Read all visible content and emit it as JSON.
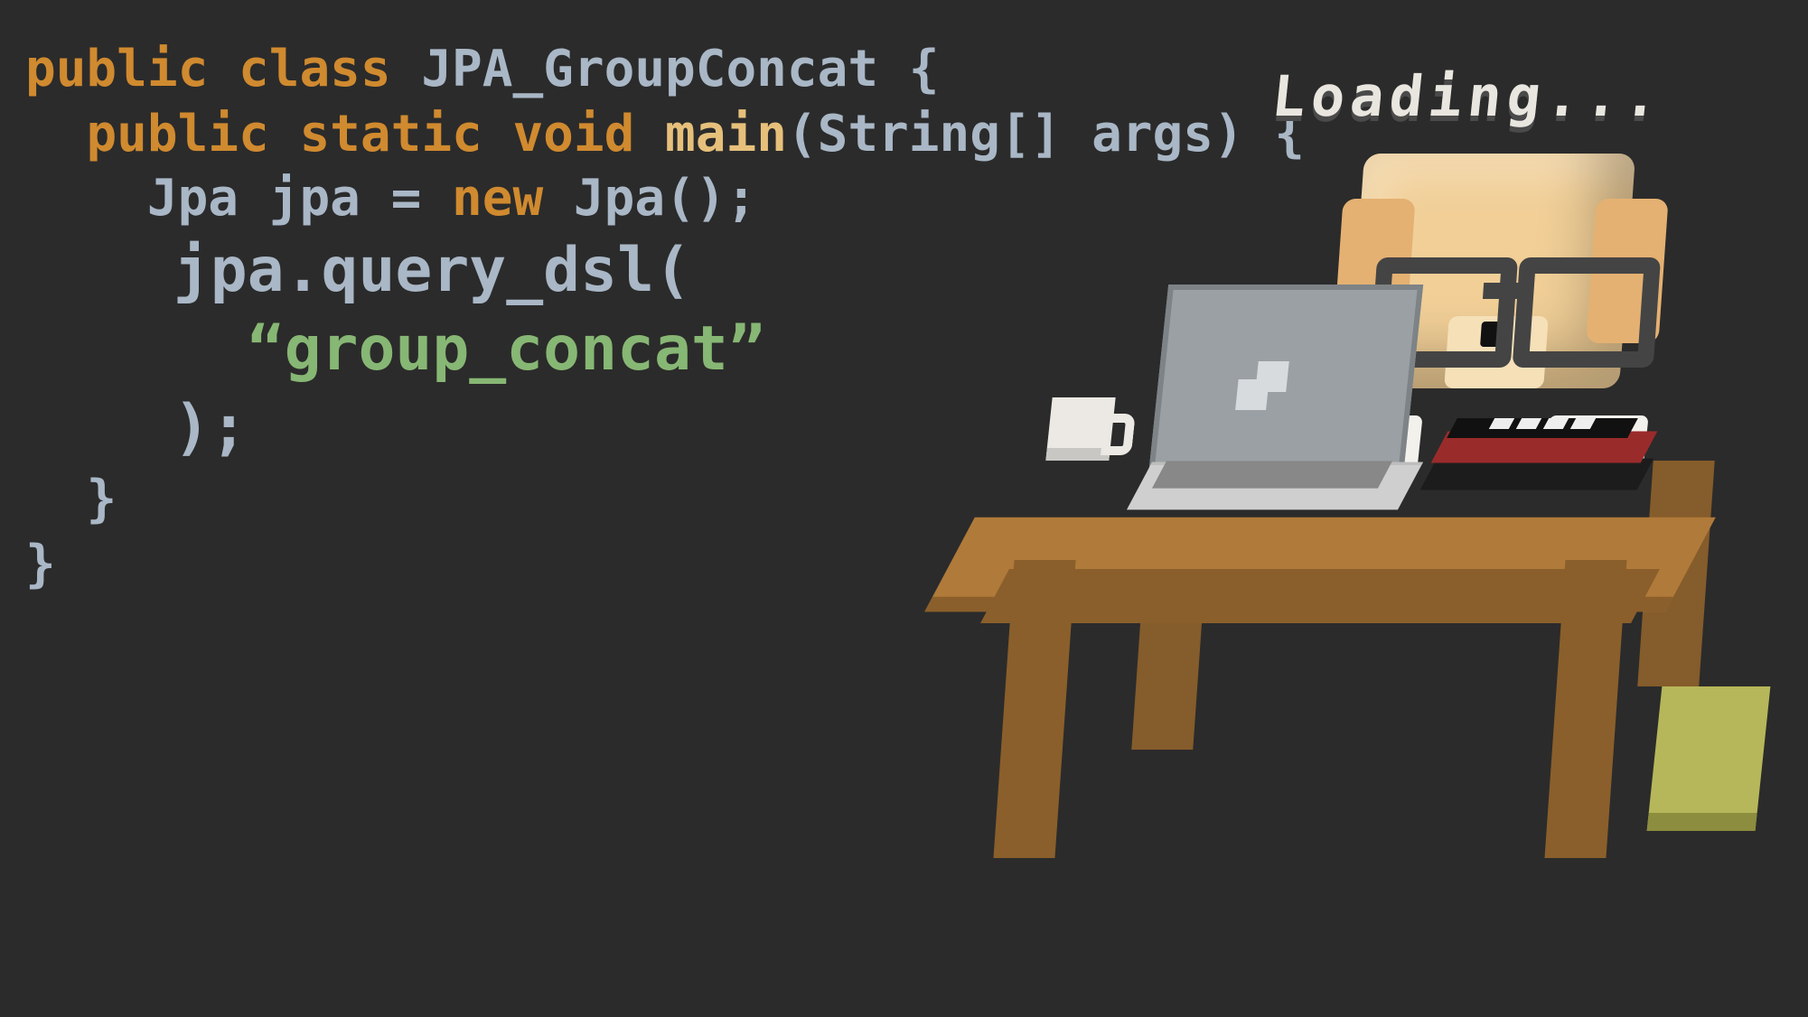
{
  "code": {
    "line1": {
      "kw1": "public",
      "kw2": "class",
      "name": "JPA_GroupConcat",
      "brace": "{"
    },
    "line2": {
      "kw1": "public",
      "kw2": "static",
      "kw3": "void",
      "fn": "main",
      "args_open": "(",
      "argtype": "String[]",
      "argname": "args",
      "args_close": ")",
      "brace": "{"
    },
    "line3": {
      "type": "Jpa",
      "var": "jpa",
      "eq": "=",
      "kw": "new",
      "ctor": "Jpa",
      "paren": "()",
      "semi": ";"
    },
    "line4": {
      "obj": "jpa",
      "dot": ".",
      "method": "query_dsl",
      "open": "("
    },
    "line5": {
      "str": "“group_concat”"
    },
    "line6": {
      "close": ")",
      "semi": ";"
    },
    "line7": {
      "brace": "}"
    },
    "line8": {
      "brace": "}"
    },
    "indent1": "  ",
    "indent2": "    ",
    "indent3": "      "
  },
  "illustration": {
    "loading_text": "Loading...",
    "items": [
      "desk",
      "laptop",
      "cup",
      "books",
      "floor-box",
      "dog-character",
      "glasses",
      "paws",
      "loading-text"
    ]
  }
}
